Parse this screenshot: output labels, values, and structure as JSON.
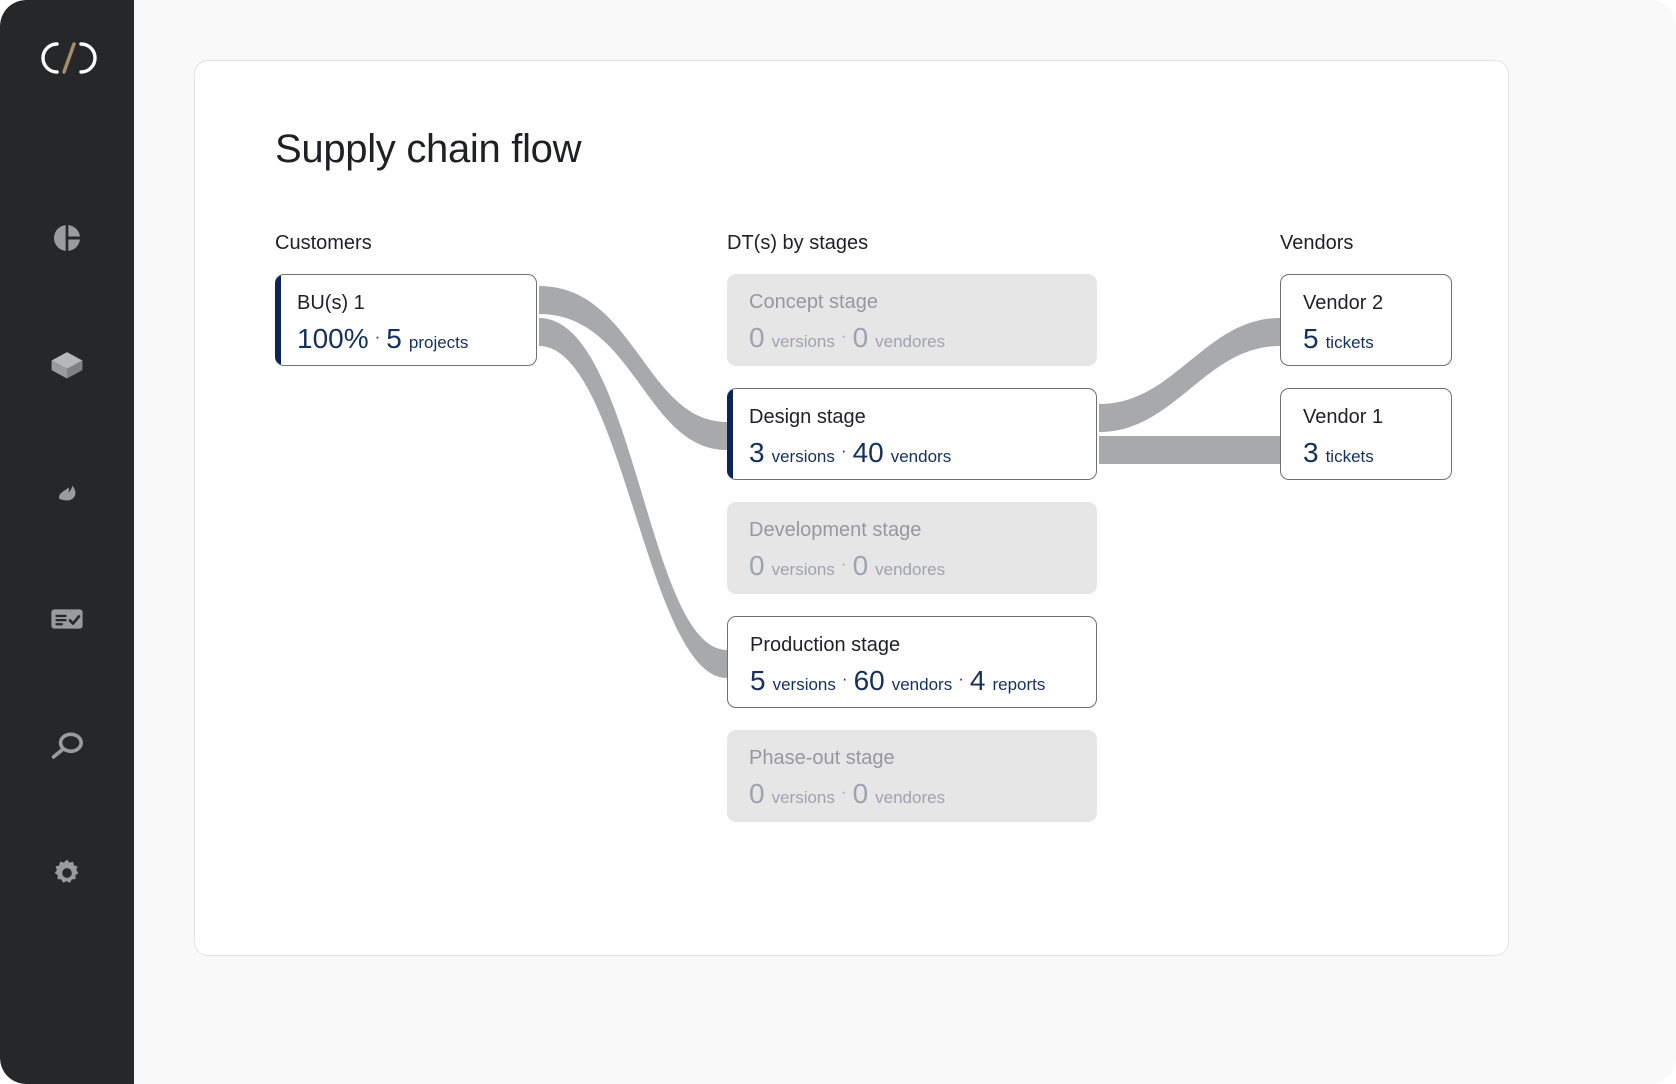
{
  "sidebar": {
    "logo": {
      "name": "brand-logo",
      "text": "C/Ɔ"
    },
    "items": [
      {
        "icon": "pie-chart-icon",
        "label": "Dashboard"
      },
      {
        "icon": "box-3d-icon",
        "label": "Products"
      },
      {
        "icon": "flame-icon",
        "label": "Trends"
      },
      {
        "icon": "task-list-icon",
        "label": "Tasks"
      },
      {
        "icon": "search-icon",
        "label": "Search"
      },
      {
        "icon": "gear-icon",
        "label": "Settings"
      }
    ]
  },
  "page": {
    "title": "Supply chain flow"
  },
  "columns": {
    "customers": "Customers",
    "stages": "DT(s) by stages",
    "vendors": "Vendors"
  },
  "customers": [
    {
      "title": "BU(s) 1",
      "state": "active",
      "metrics": [
        {
          "value": "100%",
          "label": ""
        },
        {
          "value": "5",
          "label": "projects"
        }
      ]
    }
  ],
  "stages": [
    {
      "title": "Concept stage",
      "state": "muted",
      "metrics": [
        {
          "value": "0",
          "label": "versions"
        },
        {
          "value": "0",
          "label": "vendores"
        }
      ]
    },
    {
      "title": "Design stage",
      "state": "active",
      "metrics": [
        {
          "value": "3",
          "label": "versions"
        },
        {
          "value": "40",
          "label": "vendors"
        }
      ]
    },
    {
      "title": "Development stage",
      "state": "muted",
      "metrics": [
        {
          "value": "0",
          "label": "versions"
        },
        {
          "value": "0",
          "label": "vendores"
        }
      ]
    },
    {
      "title": "Production stage",
      "state": "normal",
      "metrics": [
        {
          "value": "5",
          "label": "versions"
        },
        {
          "value": "60",
          "label": "vendors"
        },
        {
          "value": "4",
          "label": "reports"
        }
      ]
    },
    {
      "title": "Phase-out stage",
      "state": "muted",
      "metrics": [
        {
          "value": "0",
          "label": "versions"
        },
        {
          "value": "0",
          "label": "vendores"
        }
      ]
    }
  ],
  "vendors": [
    {
      "title": "Vendor 2",
      "state": "normal",
      "metrics": [
        {
          "value": "5",
          "label": "tickets"
        }
      ]
    },
    {
      "title": "Vendor 1",
      "state": "normal",
      "metrics": [
        {
          "value": "3",
          "label": "tickets"
        }
      ]
    }
  ],
  "colors": {
    "sidebar_bg": "#262729",
    "accent_navy": "#0d2555",
    "metric_navy": "#16305e",
    "ribbon_gray": "#a8a9ab",
    "muted_card_bg": "#e6e6e7",
    "muted_text": "#97989b",
    "logo_slash": "#a98c6b"
  },
  "separator": "·"
}
